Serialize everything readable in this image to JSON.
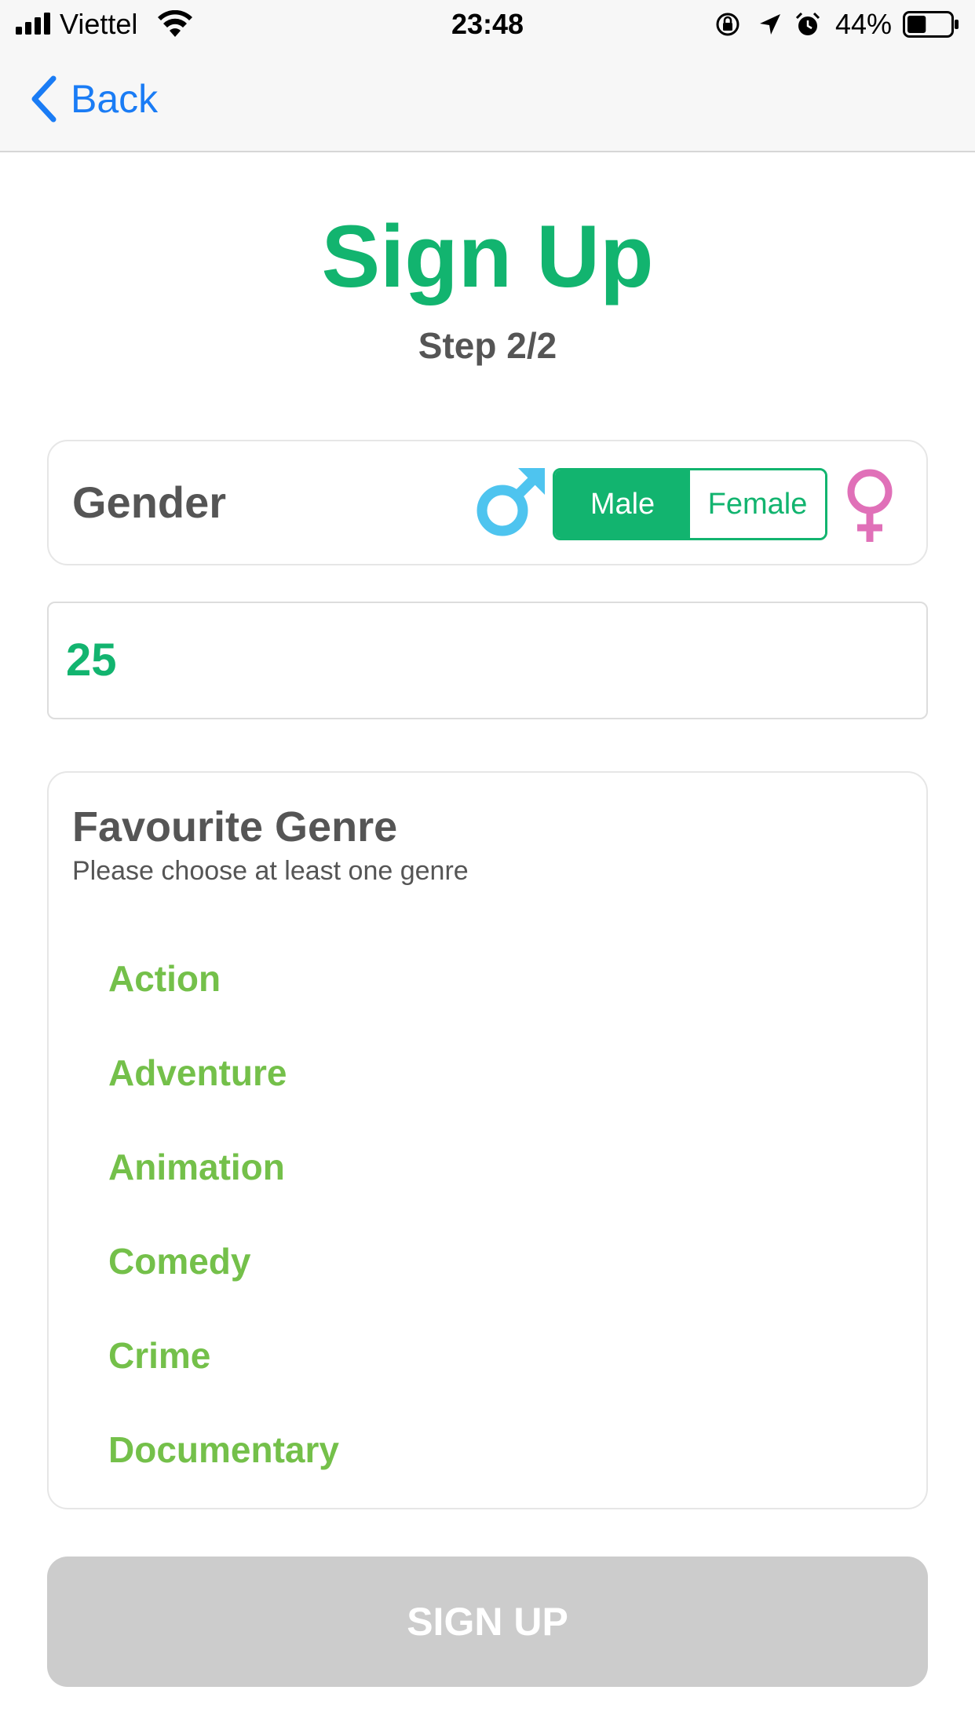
{
  "status_bar": {
    "carrier": "Viettel",
    "time": "23:48",
    "battery_percent": "44%",
    "battery_level": 0.44,
    "icons": [
      "signal-icon",
      "wifi-icon",
      "orientation-lock-icon",
      "location-icon",
      "alarm-icon",
      "battery-icon"
    ]
  },
  "nav": {
    "back_label": "Back",
    "back_icon": "chevron-left-icon"
  },
  "header": {
    "title": "Sign Up",
    "step": "Step 2/2"
  },
  "gender": {
    "label": "Gender",
    "options": [
      "Male",
      "Female"
    ],
    "selected": "Male",
    "male_icon": "male-symbol-icon",
    "female_icon": "female-symbol-icon"
  },
  "age": {
    "value": "25"
  },
  "genres": {
    "title": "Favourite Genre",
    "hint": "Please choose at least one genre",
    "items": [
      "Action",
      "Adventure",
      "Animation",
      "Comedy",
      "Crime",
      "Documentary"
    ]
  },
  "submit": {
    "label": "SIGN UP"
  },
  "colors": {
    "accent": "#12b46f",
    "genre_text": "#74c04a",
    "male": "#4ec4ef",
    "female": "#e070b8",
    "ios_blue": "#1a7cf5",
    "disabled_button": "#cccccc"
  }
}
